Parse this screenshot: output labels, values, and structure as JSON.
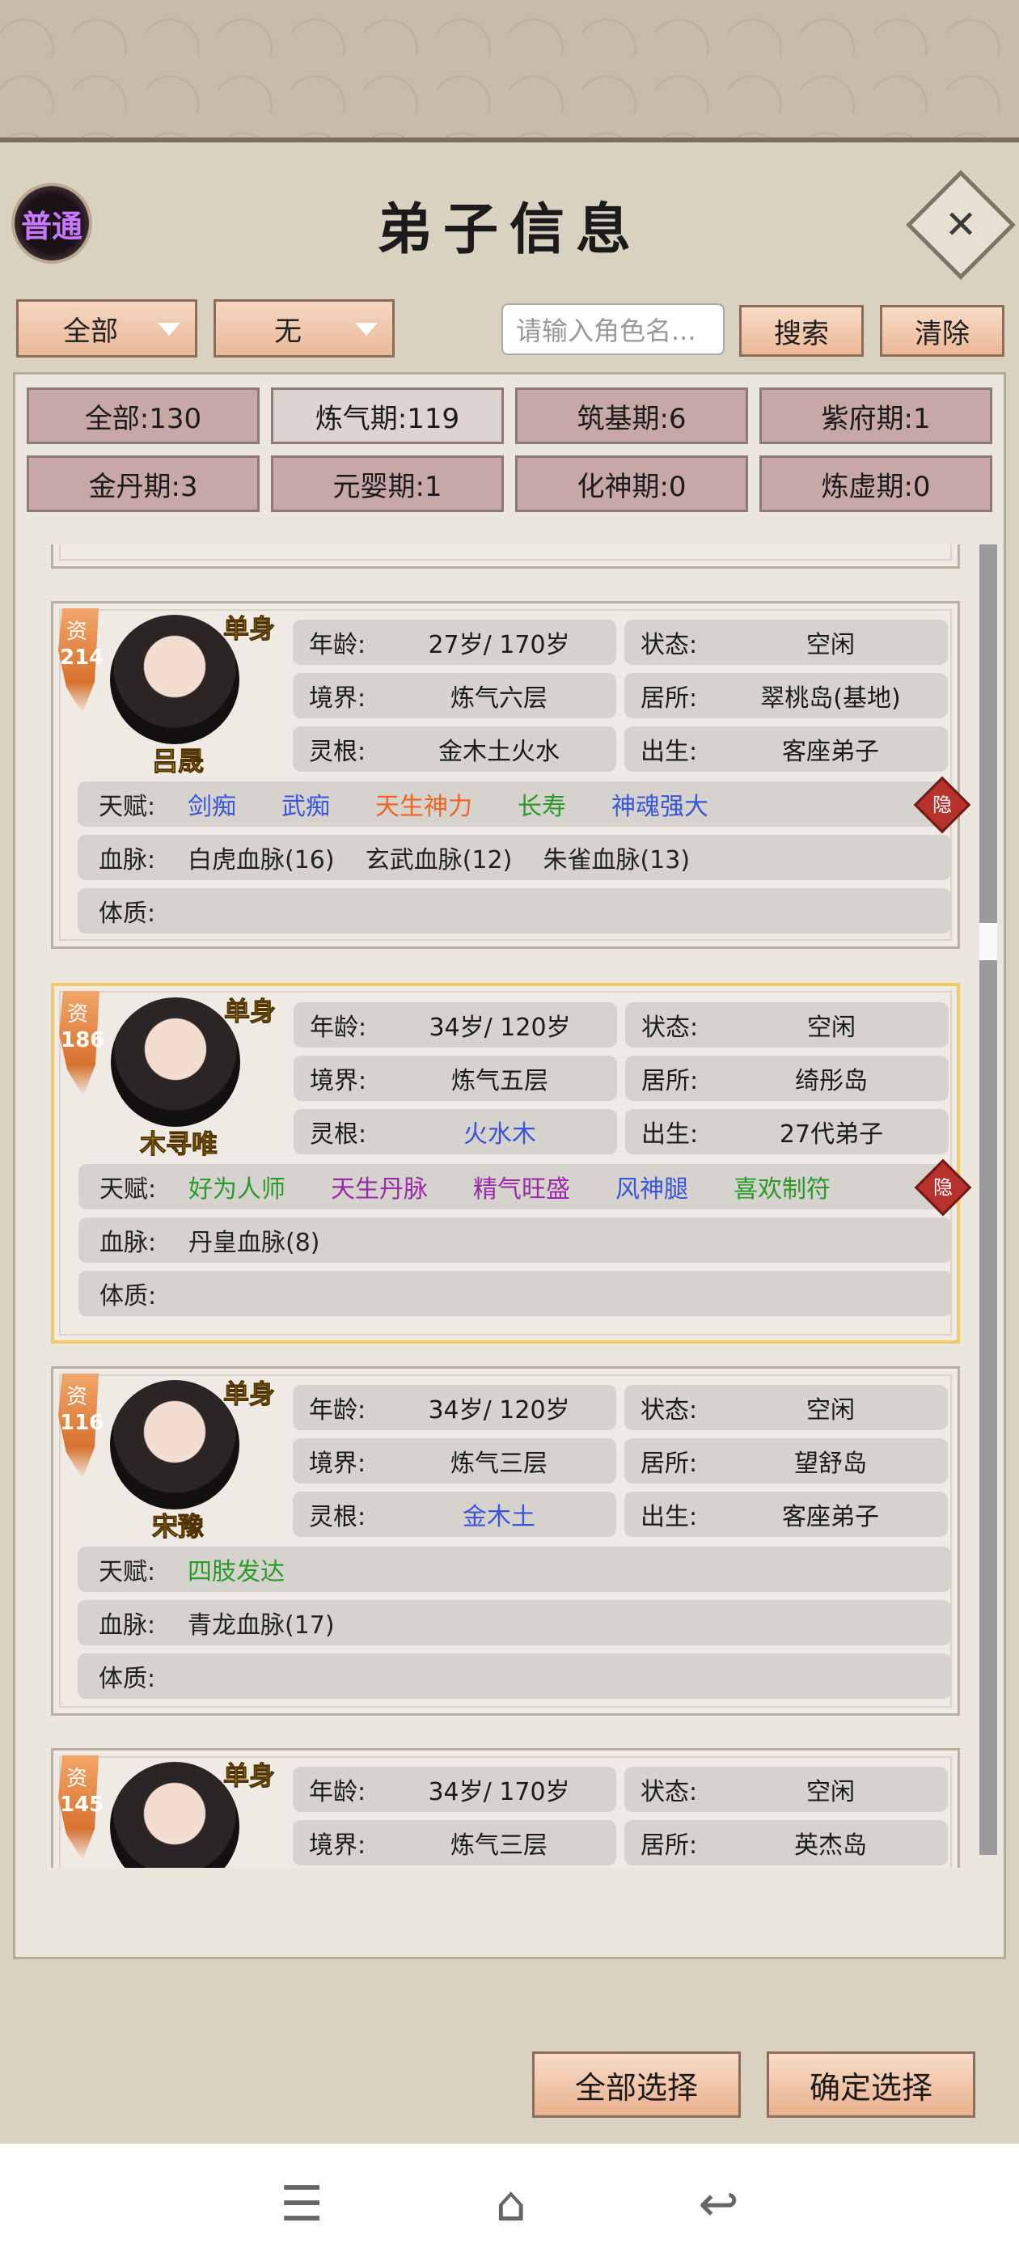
{
  "header": {
    "rank_badge": "普通",
    "title": "弟子信息",
    "close_icon": "close-icon"
  },
  "filters": {
    "dropdown1": "全部",
    "dropdown2": "无",
    "search_placeholder": "请输入角色名...",
    "search_button": "搜索",
    "clear_button": "清除"
  },
  "realm_tabs": [
    {
      "label": "全部:130"
    },
    {
      "label": "炼气期:119"
    },
    {
      "label": "筑基期:6"
    },
    {
      "label": "紫府期:1"
    },
    {
      "label": "金丹期:3"
    },
    {
      "label": "元婴期:1"
    },
    {
      "label": "化神期:0"
    },
    {
      "label": "炼虚期:0"
    }
  ],
  "labels": {
    "age": "年龄:",
    "state": "状态:",
    "realm": "境界:",
    "residence": "居所:",
    "root": "灵根:",
    "birth": "出生:",
    "talent": "天赋:",
    "bloodline": "血脉:",
    "physique": "体质:",
    "zi": "资",
    "hidden": "隐"
  },
  "disciples": [
    {
      "aptitude": "214",
      "marital": "单身",
      "name": "吕晟",
      "age": "27岁/ 170岁",
      "state": "空闲",
      "realm": "炼气六层",
      "residence": "翠桃岛(基地)",
      "root": "金木土火水",
      "birth": "客座弟子",
      "talents": [
        {
          "text": "剑痴",
          "color": "#3a55d8"
        },
        {
          "text": "武痴",
          "color": "#3a55d8"
        },
        {
          "text": "天生神力",
          "color": "#f0641e"
        },
        {
          "text": "长寿",
          "color": "#2a9a2a"
        },
        {
          "text": "神魂强大",
          "color": "#3a55d8"
        }
      ],
      "bloodline": "白虎血脉(16)    玄武血脉(12)    朱雀血脉(13)",
      "physique": ""
    },
    {
      "aptitude": "186",
      "marital": "单身",
      "name": "木寻唯",
      "age": "34岁/ 120岁",
      "state": "空闲",
      "realm": "炼气五层",
      "residence": "绮彤岛",
      "root": "火水木",
      "root_color": "#3a55d8",
      "birth": "27代弟子",
      "talents": [
        {
          "text": "好为人师",
          "color": "#2a9a2a"
        },
        {
          "text": "天生丹脉",
          "color": "#9a2aa8"
        },
        {
          "text": "精气旺盛",
          "color": "#9a2aa8"
        },
        {
          "text": "风神腿",
          "color": "#3a55d8"
        },
        {
          "text": "喜欢制符",
          "color": "#2a9a2a"
        }
      ],
      "bloodline": "丹皇血脉(8)",
      "physique": ""
    },
    {
      "aptitude": "116",
      "marital": "单身",
      "name": "宋豫",
      "age": "34岁/ 120岁",
      "state": "空闲",
      "realm": "炼气三层",
      "residence": "望舒岛",
      "root": "金木土",
      "root_color": "#3a55d8",
      "birth": "客座弟子",
      "talents": [
        {
          "text": "四肢发达",
          "color": "#2a9a2a"
        }
      ],
      "bloodline": "青龙血脉(17)",
      "physique": ""
    },
    {
      "aptitude": "145",
      "marital": "单身",
      "name": "",
      "age": "34岁/ 170岁",
      "state": "空闲",
      "realm": "炼气三层",
      "residence": "英杰岛"
    }
  ],
  "footer": {
    "select_all": "全部选择",
    "confirm": "确定选择"
  },
  "nav": {
    "menu_icon": "menu-icon",
    "home_icon": "home-icon",
    "back_icon": "back-icon"
  }
}
